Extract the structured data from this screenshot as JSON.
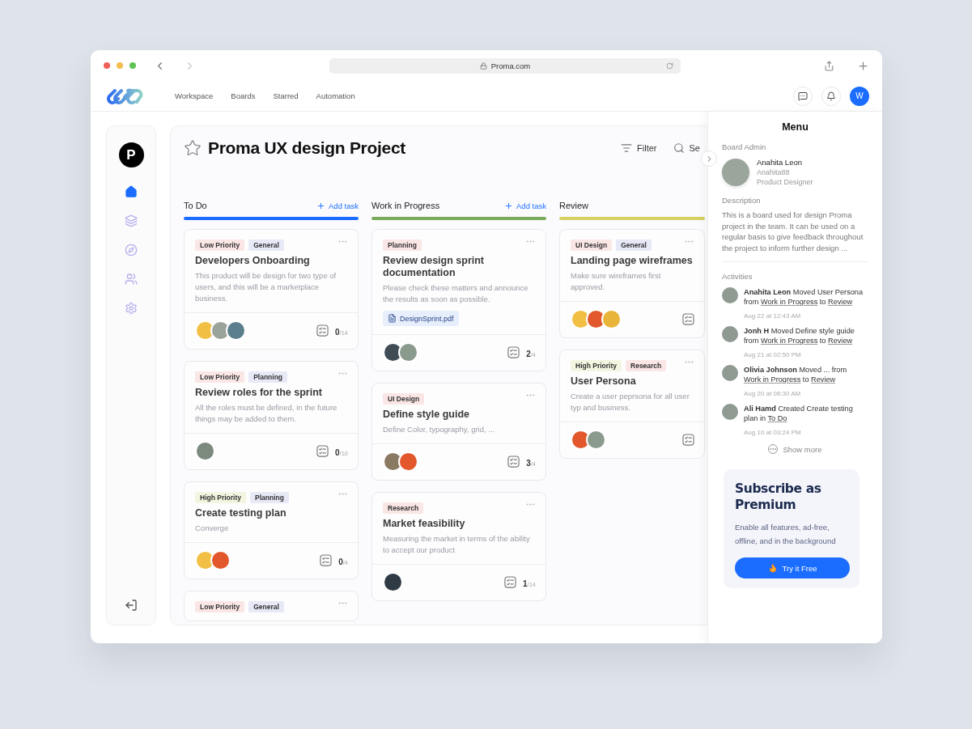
{
  "browser": {
    "url": "Proma.com"
  },
  "nav": {
    "links": [
      {
        "label": "Workspace"
      },
      {
        "label": "Boards"
      },
      {
        "label": "Starred"
      },
      {
        "label": "Automation"
      }
    ],
    "user_initial": "W"
  },
  "sidebar": {
    "logo_letter": "P",
    "items": [
      {
        "kind": "home",
        "selected": true
      },
      {
        "kind": "layers",
        "selected": false
      },
      {
        "kind": "compass",
        "selected": false
      },
      {
        "kind": "users",
        "selected": false
      },
      {
        "kind": "settings",
        "selected": false
      }
    ]
  },
  "board": {
    "title": "Proma UX design Project",
    "filter_label": "Filter",
    "search_label": "Se",
    "columns": [
      {
        "title": "To Do",
        "add_label": "Add task",
        "color": "#1a6dff",
        "cards": [
          {
            "tags": [
              {
                "label": "Low Priority",
                "color": "#fbe6e6"
              },
              {
                "label": "General",
                "color": "#e7e9f7"
              }
            ],
            "title": "Developers Onboarding",
            "description": "This product will be design for two type of users, and this will be a marketplace business.",
            "avatars": [
              {
                "color": "#f2bf45"
              },
              {
                "color": "#9aa39a"
              },
              {
                "color": "#5b7f8c"
              }
            ],
            "done": "0",
            "total": "/14"
          },
          {
            "tags": [
              {
                "label": "Low Priority",
                "color": "#fbe6e6"
              },
              {
                "label": "Planning",
                "color": "#e7e9f7"
              }
            ],
            "title": "Review roles for the sprint",
            "description": "All the roles must be defined, in the future things may be added to them.",
            "avatars": [
              {
                "color": "#7c8a7e"
              }
            ],
            "done": "0",
            "total": "/10"
          },
          {
            "tags": [
              {
                "label": "High Priority",
                "color": "#f3f5e1"
              },
              {
                "label": "Planning",
                "color": "#e7e9f7"
              }
            ],
            "title": "Create testing plan",
            "description": "Converge",
            "avatars": [
              {
                "color": "#f2bf45"
              },
              {
                "color": "#e2572b"
              }
            ],
            "done": "0",
            "total": "/4"
          },
          {
            "tags": [
              {
                "label": "Low Priority",
                "color": "#fbe6e6"
              },
              {
                "label": "General",
                "color": "#e7e9f7"
              }
            ]
          }
        ]
      },
      {
        "title": "Work in Progress",
        "add_label": "Add task",
        "color": "#7aab5c",
        "cards": [
          {
            "tags": [
              {
                "label": "Planning",
                "color": "#fbe6e6"
              }
            ],
            "title": "Review design sprint documentation",
            "description": "Please check these matters and announce the results as soon as possible.",
            "attachment": "DesignSprint.pdf",
            "avatars": [
              {
                "color": "#3f4b55"
              },
              {
                "color": "#8a9a8c"
              }
            ],
            "done": "2",
            "total": "/4"
          },
          {
            "tags": [
              {
                "label": "UI Design",
                "color": "#fbe6e6"
              }
            ],
            "title": "Define style guide",
            "description": "Define Color, typography, grid, ...",
            "avatars": [
              {
                "color": "#8a7a62"
              },
              {
                "color": "#e2572b"
              }
            ],
            "done": "3",
            "total": "/4"
          },
          {
            "tags": [
              {
                "label": "Research",
                "color": "#fbe6e6"
              }
            ],
            "title": "Market feasibility",
            "description": "Measuring the market in terms of the ability to accept our product",
            "avatars": [
              {
                "color": "#2f3a44"
              }
            ],
            "done": "1",
            "total": "/14"
          }
        ]
      },
      {
        "title": "Review",
        "color": "#d6d063",
        "cards": [
          {
            "tags": [
              {
                "label": "UI Design",
                "color": "#fbe6e6"
              },
              {
                "label": "General",
                "color": "#e7e9f7"
              }
            ],
            "title": "Landing page wireframes",
            "description": "Make sure wireframes first approved.",
            "avatars": [
              {
                "color": "#f2bf45"
              },
              {
                "color": "#e2572b"
              },
              {
                "color": "#e8b53a"
              }
            ]
          },
          {
            "tags": [
              {
                "label": "High Priority",
                "color": "#f3f5e1"
              },
              {
                "label": "Research",
                "color": "#fbe6e6"
              }
            ],
            "title": "User Persona",
            "description": "Create a user peprsona for all user typ and business.",
            "avatars": [
              {
                "color": "#e2572b"
              },
              {
                "color": "#8a9a8c"
              }
            ]
          }
        ]
      }
    ]
  },
  "menu": {
    "title": "Menu",
    "admin": {
      "label": "Board Admin",
      "name": "Anahita Leon",
      "handle": "Anahita88",
      "role": "Product Designer"
    },
    "description": {
      "label": "Description",
      "text": "This is a board used for design Proma project in the team. It can be used on a regular basis to give feedback throughout the project to inform further design ..."
    },
    "activities": {
      "label": "Activities",
      "more_label": "Show more",
      "items": [
        {
          "parts": [
            {
              "kind": "bold",
              "text": "Anahita Leon"
            },
            {
              "kind": "plain",
              "text": " Moved User Persona from "
            },
            {
              "kind": "link",
              "text": "Work in Progress"
            },
            {
              "kind": "plain",
              "text": " to "
            },
            {
              "kind": "link",
              "text": "Review"
            }
          ],
          "time": "Aug 22 at 12:43 AM"
        },
        {
          "parts": [
            {
              "kind": "bold",
              "text": "Jonh H"
            },
            {
              "kind": "plain",
              "text": " Moved Define style guide from "
            },
            {
              "kind": "link",
              "text": "Work in Progress"
            },
            {
              "kind": "plain",
              "text": " to "
            },
            {
              "kind": "link",
              "text": "Review"
            }
          ],
          "time": "Aug 21 at 02:50 PM"
        },
        {
          "parts": [
            {
              "kind": "bold",
              "text": "Olivia Johnson"
            },
            {
              "kind": "plain",
              "text": " Moved ... from "
            },
            {
              "kind": "link",
              "text": "Work in Progress"
            },
            {
              "kind": "plain",
              "text": " to "
            },
            {
              "kind": "link",
              "text": "Review"
            }
          ],
          "time": "Aug 20 at 06:30 AM"
        },
        {
          "parts": [
            {
              "kind": "bold",
              "text": "Ali Hamd"
            },
            {
              "kind": "plain",
              "text": " Created Create testing plan in "
            },
            {
              "kind": "link",
              "text": "To Do"
            }
          ],
          "time": "Aug 10 at 03:24 PM"
        }
      ]
    },
    "premium": {
      "title": "Subscribe as Premium",
      "text": "Enable all features, ad-free, offline, and in the background",
      "button": "Try it Free"
    }
  }
}
